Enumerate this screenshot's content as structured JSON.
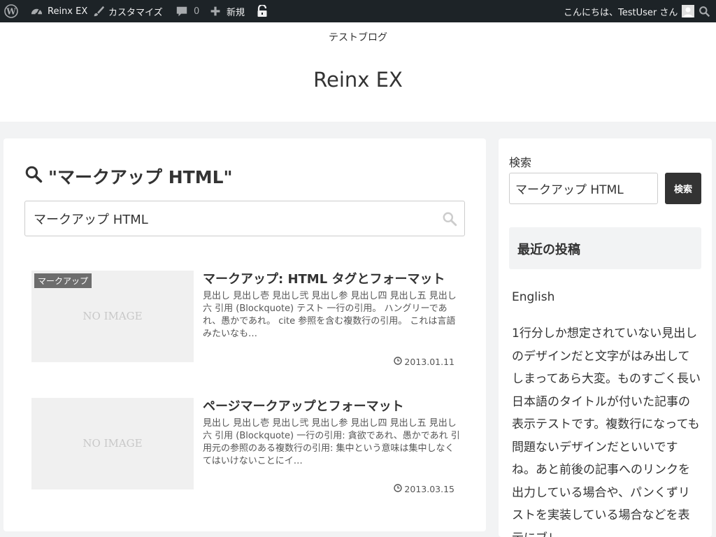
{
  "admin_bar": {
    "site_name": "Reinx EX",
    "customize": "カスタマイズ",
    "comments_count": "0",
    "new": "新規",
    "greeting": "こんにちは、TestUser さん"
  },
  "header": {
    "tagline": "テストブログ",
    "title": "Reinx EX"
  },
  "search": {
    "heading": "\"マークアップ HTML\"",
    "query": "マークアップ HTML"
  },
  "results": [
    {
      "category": "マークアップ",
      "no_image": "NO IMAGE",
      "title": "マークアップ: HTML タグとフォーマット",
      "excerpt": "見出し 見出し壱 見出し弐 見出し参 見出し四 見出し五 見出し六 引用 (Blockquote) テスト 一行の引用。 ハングリーであれ、愚かであれ。 cite 参照を含む複数行の引用。 これは言語みたいなも…",
      "date": "2013.01.11"
    },
    {
      "no_image": "NO IMAGE",
      "title": "ページマークアップとフォーマット",
      "excerpt": "見出し 見出し壱 見出し弐 見出し参 見出し四 見出し五 見出し六 引用 (Blockquote) 一行の引用: 貪欲であれ、愚かであれ 引用元の参照のある複数行の引用: 集中という意味は集中しなくてはいけないことにイ…",
      "date": "2013.03.15"
    }
  ],
  "sidebar": {
    "search_label": "検索",
    "search_value": "マークアップ HTML",
    "search_button": "検索",
    "recent_heading": "最近の投稿",
    "recent_posts": [
      "English",
      "1行分しか想定されていない見出しのデザインだと文字がはみ出してしまってあら大変。ものすごく長い日本語のタイトルが付いた記事の表示テストです。複数行になっても問題ないデザインだといいですね。あと前後の記事へのリンクを出力している場合や、パンくずリストを実装している場合などを表示にブレ"
    ]
  },
  "colors": {
    "admin_bar_bg": "#1d2327",
    "page_bg": "#f2f3f4",
    "button_bg": "#333333"
  },
  "icons": {
    "wordpress": "wordpress-logo-icon",
    "dashboard": "dashboard-icon",
    "customize": "brush-icon",
    "comments": "comment-icon",
    "new": "plus-icon",
    "lock": "lock-icon",
    "avatar": "avatar-icon",
    "search": "search-icon",
    "clock": "clock-icon"
  }
}
